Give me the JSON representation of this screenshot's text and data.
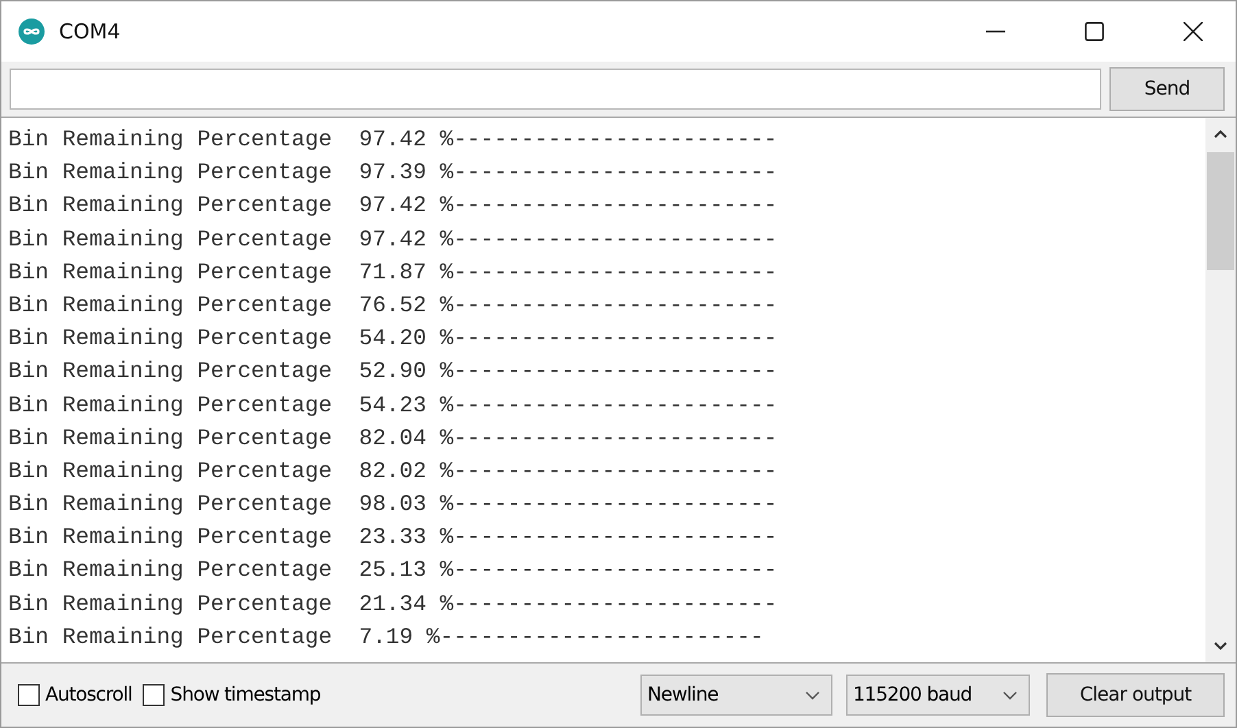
{
  "window": {
    "title": "COM4"
  },
  "send_button": "Send",
  "output_lines": [
    "Bin Remaining Percentage  97.42 %------------------------",
    "Bin Remaining Percentage  97.39 %------------------------",
    "Bin Remaining Percentage  97.42 %------------------------",
    "Bin Remaining Percentage  97.42 %------------------------",
    "Bin Remaining Percentage  71.87 %------------------------",
    "Bin Remaining Percentage  76.52 %------------------------",
    "Bin Remaining Percentage  54.20 %------------------------",
    "Bin Remaining Percentage  52.90 %------------------------",
    "Bin Remaining Percentage  54.23 %------------------------",
    "Bin Remaining Percentage  82.04 %------------------------",
    "Bin Remaining Percentage  82.02 %------------------------",
    "Bin Remaining Percentage  98.03 %------------------------",
    "Bin Remaining Percentage  23.33 %------------------------",
    "Bin Remaining Percentage  25.13 %------------------------",
    "Bin Remaining Percentage  21.34 %------------------------",
    "Bin Remaining Percentage  7.19 %------------------------"
  ],
  "options": [
    {
      "label": "Autoscroll",
      "checked": false
    },
    {
      "label": "Show timestamp",
      "checked": false
    }
  ],
  "line_ending": "Newline",
  "baud_rate": "115200 baud",
  "clear_button": "Clear output"
}
